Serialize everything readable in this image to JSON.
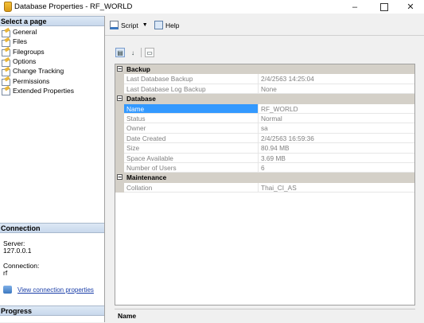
{
  "window": {
    "title": "Database Properties - RF_WORLD",
    "minimize": "–",
    "close": "✕"
  },
  "left": {
    "select_page_header": "Select a page",
    "pages": [
      {
        "label": "General",
        "icon": "page-icon"
      },
      {
        "label": "Files",
        "icon": "page-icon"
      },
      {
        "label": "Filegroups",
        "icon": "page-icon"
      },
      {
        "label": "Options",
        "icon": "page-icon"
      },
      {
        "label": "Change Tracking",
        "icon": "page-icon"
      },
      {
        "label": "Permissions",
        "icon": "page-icon"
      },
      {
        "label": "Extended Properties",
        "icon": "page-icon"
      }
    ],
    "connection_header": "Connection",
    "server_label": "Server:",
    "server_value": "127.0.0.1",
    "connection_label": "Connection:",
    "connection_value": "rf",
    "view_connection_link": "View connection properties",
    "progress_header": "Progress"
  },
  "toolbar": {
    "script_label": "Script",
    "help_label": "Help"
  },
  "grid": {
    "categories": [
      {
        "name": "Backup",
        "rows": [
          {
            "name": "Last Database Backup",
            "value": "2/4/2563 14:25:04"
          },
          {
            "name": "Last Database Log Backup",
            "value": "None"
          }
        ]
      },
      {
        "name": "Database",
        "rows": [
          {
            "name": "Name",
            "value": "RF_WORLD",
            "selected": true
          },
          {
            "name": "Status",
            "value": "Normal"
          },
          {
            "name": "Owner",
            "value": "sa"
          },
          {
            "name": "Date Created",
            "value": "2/4/2563 16:59:36"
          },
          {
            "name": "Size",
            "value": "80.94 MB"
          },
          {
            "name": "Space Available",
            "value": "3.69 MB"
          },
          {
            "name": "Number of Users",
            "value": "6"
          }
        ]
      },
      {
        "name": "Maintenance",
        "rows": [
          {
            "name": "Collation",
            "value": "Thai_CI_AS"
          }
        ]
      }
    ],
    "description_title": "Name"
  },
  "colors": {
    "selection": "#3399ff",
    "category_band": "#d4d0c8",
    "link": "#1a3ea8"
  }
}
